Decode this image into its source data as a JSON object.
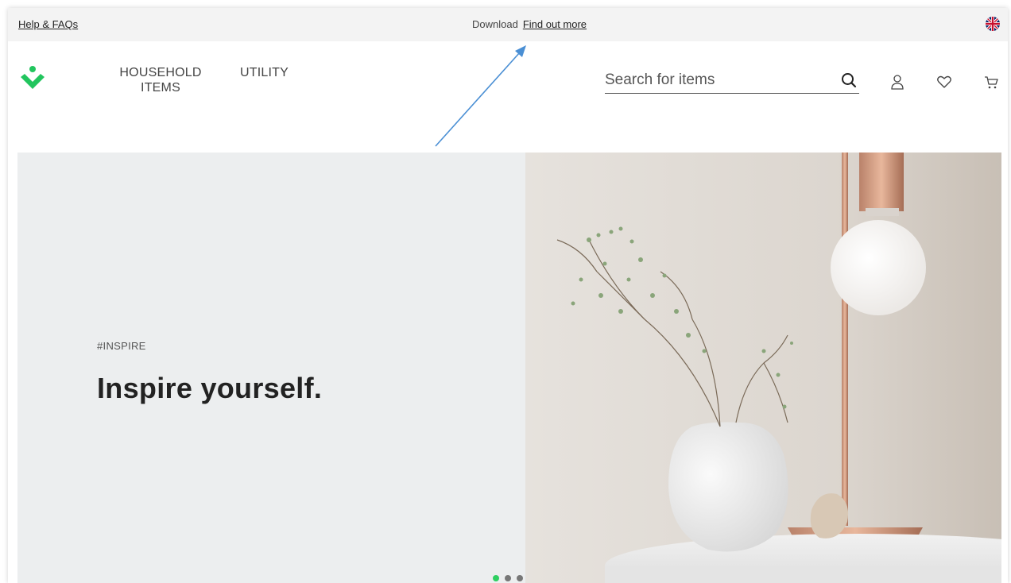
{
  "topbar": {
    "help_link": "Help & FAQs",
    "promo_label": "Download",
    "promo_link": "Find out more",
    "language_icon": "uk-flag-icon"
  },
  "header": {
    "logo_icon": "brand-logo-icon",
    "nav": [
      {
        "label": "HOUSEHOLD ITEMS"
      },
      {
        "label": "UTILITY"
      }
    ],
    "search": {
      "placeholder": "Search for items",
      "value": ""
    },
    "icons": [
      "search-icon",
      "user-icon",
      "heart-icon",
      "cart-icon"
    ]
  },
  "hero": {
    "tag": "#INSPIRE",
    "title": "Inspire yourself.",
    "slides_total": 3,
    "active_slide": 1
  },
  "colors": {
    "brand_green": "#22c55e",
    "topbar_bg": "#f3f3f3",
    "hero_bg": "#eceeef",
    "annotation_arrow": "#4a8fd4"
  }
}
